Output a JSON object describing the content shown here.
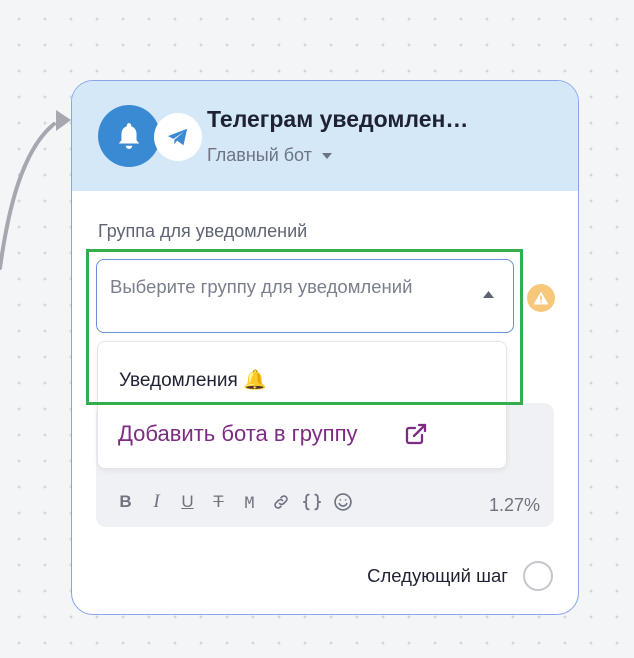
{
  "node": {
    "title": "Телеграм уведомлен…",
    "bot_name": "Главный бот",
    "header_icon": "bell-icon",
    "channel_icon": "telegram-icon"
  },
  "group_field": {
    "label": "Группа для уведомлений",
    "placeholder": "Выберите группу для уведомлений",
    "warning_icon": "warning-icon"
  },
  "dropdown": {
    "options": [
      {
        "label": "Уведомления 🔔"
      },
      {
        "label": "Добавить бота в группу",
        "icon": "external-link-icon"
      }
    ]
  },
  "toolbar": {
    "bold": "B",
    "italic": "I",
    "underline": "U",
    "strikethrough": "T",
    "monospace": "M",
    "char_count": "1.27%"
  },
  "next_step": {
    "label": "Следующий шаг"
  },
  "colors": {
    "accent": "#3a8ad3",
    "header_bg": "#d4e8f7",
    "link": "#7c2d83",
    "highlight": "#34ad4e",
    "warning": "#f7c77a"
  }
}
